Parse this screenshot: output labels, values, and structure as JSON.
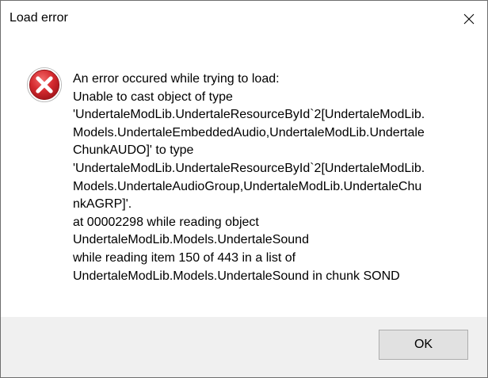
{
  "window": {
    "title": "Load error",
    "close_icon": "close-icon"
  },
  "icon": {
    "name": "error-icon",
    "color": "#c8202a"
  },
  "message": {
    "lines": [
      "An error occured while trying to load:",
      "Unable to cast object of type",
      "'UndertaleModLib.UndertaleResourceById`2[UndertaleModLib.",
      "Models.UndertaleEmbeddedAudio,UndertaleModLib.Undertale",
      "ChunkAUDO]' to type",
      "'UndertaleModLib.UndertaleResourceById`2[UndertaleModLib.",
      "Models.UndertaleAudioGroup,UndertaleModLib.UndertaleChu",
      "nkAGRP]'.",
      "at 00002298 while reading object",
      "UndertaleModLib.Models.UndertaleSound",
      "while reading item 150 of 443 in a list of",
      "UndertaleModLib.Models.UndertaleSound in chunk SOND"
    ]
  },
  "footer": {
    "ok_label": "OK",
    "background": "#f0f0f0"
  }
}
